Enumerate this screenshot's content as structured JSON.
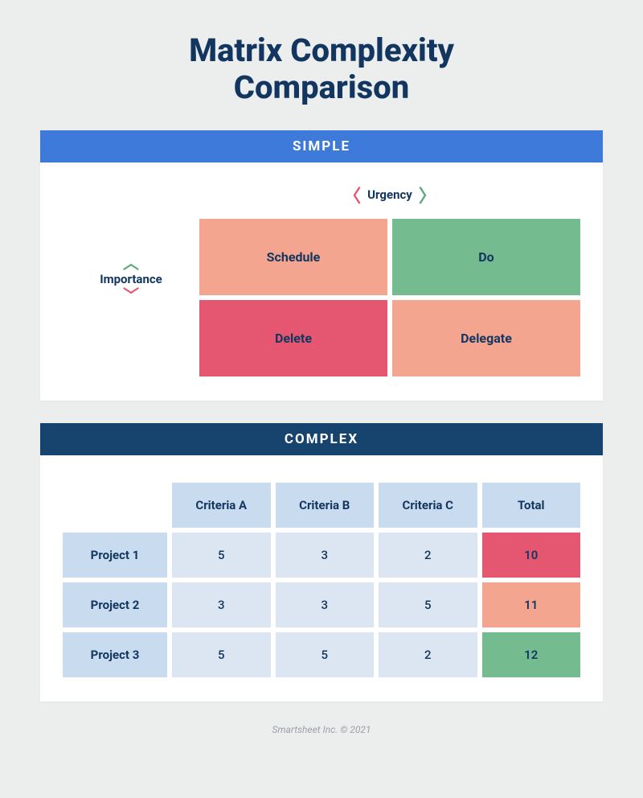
{
  "title_line1": "Matrix Complexity",
  "title_line2": "Comparison",
  "simple": {
    "header": "SIMPLE",
    "xlabel": "Urgency",
    "ylabel": "Importance",
    "quadrants": {
      "schedule": "Schedule",
      "do": "Do",
      "delete": "Delete",
      "delegate": "Delegate"
    }
  },
  "complex": {
    "header": "COMPLEX",
    "columns": [
      "Criteria A",
      "Criteria B",
      "Criteria C",
      "Total"
    ],
    "rows": [
      {
        "name": "Project 1",
        "values": [
          "5",
          "3",
          "2"
        ],
        "total": "10",
        "total_color": "red"
      },
      {
        "name": "Project 2",
        "values": [
          "3",
          "3",
          "5"
        ],
        "total": "11",
        "total_color": "peach"
      },
      {
        "name": "Project 3",
        "values": [
          "5",
          "5",
          "2"
        ],
        "total": "12",
        "total_color": "green"
      }
    ]
  },
  "footer": "Smartsheet Inc. © 2021",
  "chart_data": {
    "type": "table",
    "title": "Matrix Complexity Comparison",
    "simple_matrix": {
      "x_axis": "Urgency",
      "y_axis": "Importance",
      "cells": [
        {
          "importance": "high",
          "urgency": "low",
          "action": "Schedule"
        },
        {
          "importance": "high",
          "urgency": "high",
          "action": "Do"
        },
        {
          "importance": "low",
          "urgency": "low",
          "action": "Delete"
        },
        {
          "importance": "low",
          "urgency": "high",
          "action": "Delegate"
        }
      ]
    },
    "complex_matrix": {
      "criteria": [
        "Criteria A",
        "Criteria B",
        "Criteria C"
      ],
      "projects": [
        {
          "name": "Project 1",
          "scores": [
            5,
            3,
            2
          ],
          "total": 10
        },
        {
          "name": "Project 2",
          "scores": [
            3,
            3,
            5
          ],
          "total": 11
        },
        {
          "name": "Project 3",
          "scores": [
            5,
            5,
            2
          ],
          "total": 12
        }
      ]
    }
  }
}
